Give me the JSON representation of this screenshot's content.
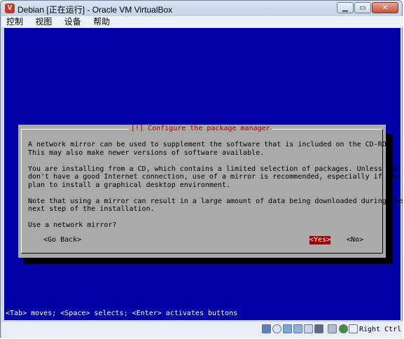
{
  "window": {
    "title": "Debian [正在运行] - Oracle VM VirtualBox",
    "app_icon_glyph": "V",
    "minimize_glyph": "▁",
    "maximize_glyph": "▭",
    "close_glyph": "✕"
  },
  "menu": {
    "items": [
      "控制",
      "视图",
      "设备",
      "帮助"
    ]
  },
  "dialog": {
    "title": "[!] Configure the package manager",
    "paragraphs": [
      "A network mirror can be used to supplement the software that is included on the CD-ROM.",
      "This may also make newer versions of software available.",
      "You are installing from a CD, which contains a limited selection of packages. Unless you",
      "don't have a good Internet connection, use of a mirror is recommended, especially if you",
      "plan to install a graphical desktop environment.",
      "Note that using a mirror can result in a large amount of data being downloaded during the",
      "next step of the installation.",
      "Use a network mirror?"
    ],
    "buttons": {
      "go_back": "<Go Back>",
      "yes": "<Yes>",
      "no": "<No>"
    }
  },
  "hint": "<Tab> moves; <Space> selects; <Enter> activates buttons",
  "statusbar": {
    "host_key": "Right Ctrl",
    "icons": [
      "hard-disk",
      "optical-drive",
      "usb",
      "shared-folders",
      "network",
      "display",
      "mouse-integration",
      "virtualbox"
    ]
  }
}
